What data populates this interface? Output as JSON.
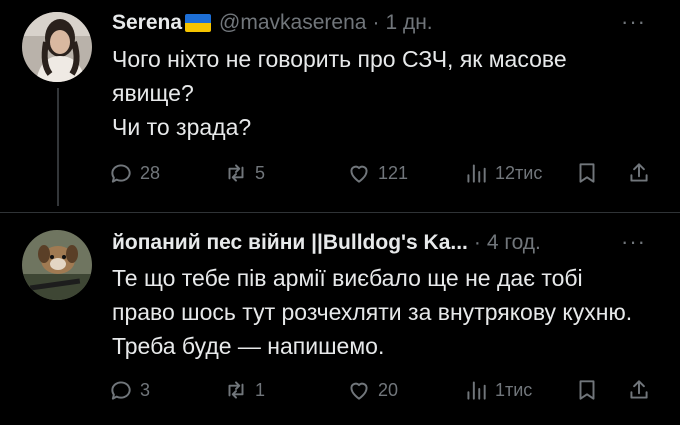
{
  "tweets": [
    {
      "name": "Serena",
      "handle": "@mavkaserena",
      "time": "1 дн.",
      "more": "···",
      "text": [
        "Чого ніхто не говорить про СЗЧ, як масове явище?",
        "Чи то зрада?"
      ],
      "replies": "28",
      "reposts": "5",
      "likes": "121",
      "views": "12тис"
    },
    {
      "name": "йопаний пес війни ||Bulldog's Ka...",
      "time": "4 год.",
      "more": "···",
      "text": [
        "Те що тебе пів армії виєбало ще не дає тобі право шось тут розчехляти за внутрякову кухню. Треба буде — напишемо."
      ],
      "replies": "3",
      "reposts": "1",
      "likes": "20",
      "views": "1тис"
    }
  ],
  "colors": {
    "background": "#000000",
    "text": "#e7e9ea",
    "muted": "#71767b",
    "divider": "#2f3336",
    "flag_blue": "#1d6fd6",
    "flag_yellow": "#f5c400"
  },
  "icons": [
    "reply-icon",
    "repost-icon",
    "like-icon",
    "views-icon",
    "bookmark-icon",
    "share-icon",
    "more-icon",
    "ukraine-flag-icon"
  ]
}
